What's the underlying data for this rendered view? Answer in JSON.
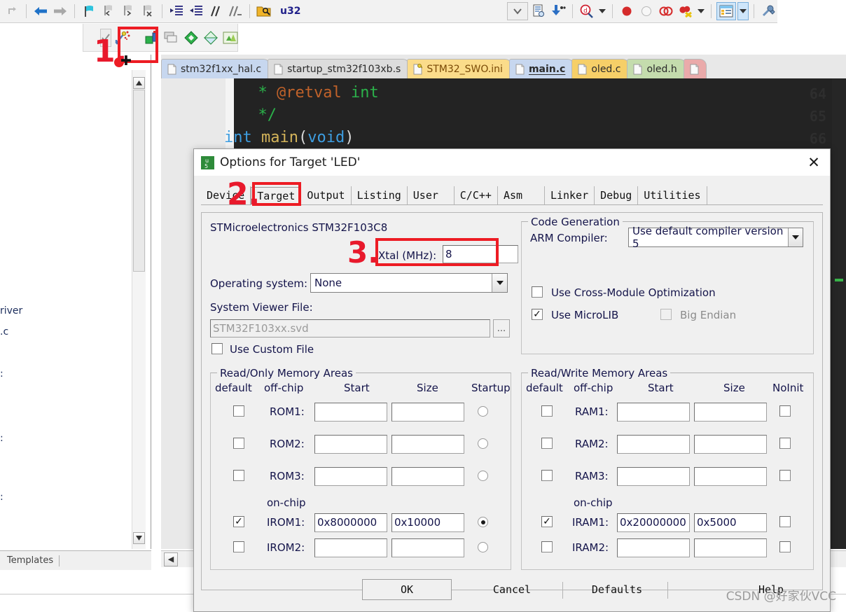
{
  "ide": {
    "toolbar_label": "u32",
    "toolbar_icons": [
      "redo-icon",
      "back-arrow-icon",
      "forward-arrow-icon",
      "bookmark-icon",
      "bookmark-prev-icon",
      "bookmark-next-icon",
      "bookmark-clear-icon",
      "indent-right-icon",
      "indent-left-icon",
      "comment-icon",
      "uncomment-icon",
      "open-folder-search-icon"
    ],
    "toolbar_right_icons": [
      "dropdown-chevron-icon",
      "file-properties-icon",
      "download-icon",
      "debug-search-icon",
      "breakpoint-icon",
      "disabled-breakpoint-icon",
      "toggle-breakpoints-icon",
      "kill-breakpoints-icon",
      "manage-components-icon",
      "configure-wizard-icon"
    ],
    "secondary_toolbar_icons": [
      "checkbox-icon",
      "magic-wand-icon",
      "target-options-icon",
      "manage-project-icon",
      "pack-installer-icon",
      "green-diamond-icon",
      "multi-project-icon"
    ],
    "project_panel": {
      "fragments": [
        "river",
        ".c",
        ":",
        ":",
        ":"
      ],
      "tab_label": "Templates"
    },
    "file_tabs": [
      {
        "label": "stm32f1xx_hal.c",
        "icon": "document-icon",
        "state": "inactive-blue"
      },
      {
        "label": "startup_stm32f103xb.s",
        "icon": "document-icon",
        "state": "inactive-gray"
      },
      {
        "label": "STM32_SWO.ini",
        "icon": "key-document-icon",
        "state": "ini-yellow"
      },
      {
        "label": "main.c",
        "icon": "document-icon",
        "state": "active"
      },
      {
        "label": "oled.c",
        "icon": "document-icon",
        "state": "yellow"
      },
      {
        "label": "oled.h",
        "icon": "document-icon",
        "state": "green"
      },
      {
        "label": "",
        "icon": "document-icon",
        "state": "pink"
      }
    ],
    "code": {
      "line_numbers": [
        "64",
        "65",
        "66"
      ],
      "lines": [
        [
          {
            "t": "  * ",
            "c": "green"
          },
          {
            "t": "@retval ",
            "c": "orange"
          },
          {
            "t": "int",
            "c": "green"
          }
        ],
        [
          {
            "t": "  */",
            "c": "green"
          }
        ],
        [
          {
            "t": "int ",
            "c": "blue"
          },
          {
            "t": "main",
            "c": "tan"
          },
          {
            "t": "(",
            "c": "white"
          },
          {
            "t": "void",
            "c": "blue"
          },
          {
            "t": ")",
            "c": "white"
          }
        ]
      ]
    }
  },
  "dialog": {
    "title": "Options for Target 'LED'",
    "title_icon": "keil-uvision-icon",
    "close_label": "✕",
    "tabs": [
      {
        "label": "Device",
        "active": false
      },
      {
        "label": "Target",
        "active": true
      },
      {
        "label": "Output",
        "active": false
      },
      {
        "label": "Listing",
        "active": false
      },
      {
        "label": "User",
        "active": false
      },
      {
        "label": "C/C++",
        "active": false
      },
      {
        "label": "Asm",
        "active": false
      },
      {
        "label": "Linker",
        "active": false
      },
      {
        "label": "Debug",
        "active": false
      },
      {
        "label": "Utilities",
        "active": false
      }
    ],
    "device_name": "STMicroelectronics STM32F103C8",
    "xtal": {
      "label": "Xtal (MHz):",
      "value": "8"
    },
    "operating_system": {
      "label": "Operating system:",
      "value": "None"
    },
    "system_viewer": {
      "label": "System Viewer File:",
      "value": "STM32F103xx.svd",
      "browse_label": "..."
    },
    "use_custom_file": {
      "label": "Use Custom File",
      "checked": false
    },
    "code_generation": {
      "title": "Code Generation",
      "arm_compiler_label": "ARM Compiler:",
      "arm_compiler_value": "Use default compiler version 5",
      "cross_module": {
        "label": "Use Cross-Module Optimization",
        "checked": false
      },
      "microlib": {
        "label": "Use MicroLIB",
        "checked": true
      },
      "big_endian": {
        "label": "Big Endian",
        "checked": false,
        "disabled": true
      }
    },
    "rom_group": {
      "title": "Read/Only Memory Areas",
      "headers": [
        "default",
        "off-chip",
        "Start",
        "Size",
        "Startup"
      ],
      "offchip_rows": [
        {
          "name": "ROM1:",
          "default": false,
          "start": "",
          "size": "",
          "startup": false
        },
        {
          "name": "ROM2:",
          "default": false,
          "start": "",
          "size": "",
          "startup": false
        },
        {
          "name": "ROM3:",
          "default": false,
          "start": "",
          "size": "",
          "startup": false
        }
      ],
      "onchip_label": "on-chip",
      "onchip_rows": [
        {
          "name": "IROM1:",
          "default": true,
          "start": "0x8000000",
          "size": "0x10000",
          "startup": true
        },
        {
          "name": "IROM2:",
          "default": false,
          "start": "",
          "size": "",
          "startup": false
        }
      ]
    },
    "ram_group": {
      "title": "Read/Write Memory Areas",
      "headers": [
        "default",
        "off-chip",
        "Start",
        "Size",
        "NoInit"
      ],
      "offchip_rows": [
        {
          "name": "RAM1:",
          "default": false,
          "start": "",
          "size": "",
          "noinit": false
        },
        {
          "name": "RAM2:",
          "default": false,
          "start": "",
          "size": "",
          "noinit": false
        },
        {
          "name": "RAM3:",
          "default": false,
          "start": "",
          "size": "",
          "noinit": false
        }
      ],
      "onchip_label": "on-chip",
      "onchip_rows": [
        {
          "name": "IRAM1:",
          "default": true,
          "start": "0x20000000",
          "size": "0x5000",
          "noinit": false
        },
        {
          "name": "IRAM2:",
          "default": false,
          "start": "",
          "size": "",
          "noinit": false
        }
      ]
    },
    "buttons": {
      "ok": "OK",
      "cancel": "Cancel",
      "defaults": "Defaults",
      "help": "Help"
    }
  },
  "annotations": {
    "step1": "1.",
    "step2": "2.",
    "step3": "3."
  },
  "watermark": "CSDN @好家伙VCC",
  "colors": {
    "annotation_red": "#ed1c24",
    "dialog_bg": "#f0f0f0",
    "label_blue": "#14144a",
    "editor_bg": "#232323",
    "active_tab": "#c7d7ef"
  }
}
